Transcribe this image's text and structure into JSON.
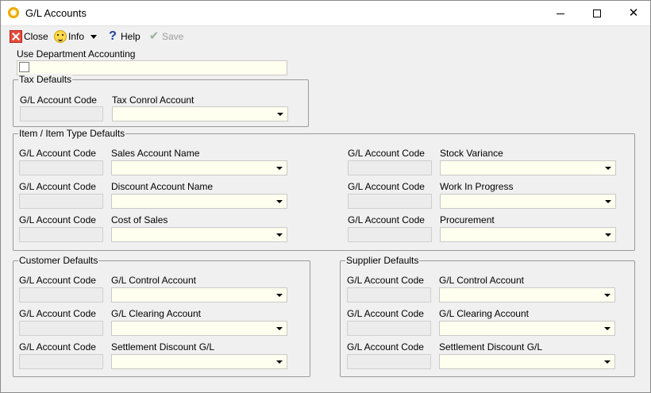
{
  "window": {
    "title": "G/L Accounts"
  },
  "toolbar": {
    "close_label": "Close",
    "info_label": "Info",
    "help_label": "Help",
    "save_label": "Save",
    "help_glyph": "?",
    "save_glyph": "✔"
  },
  "dept": {
    "label": "Use Department Accounting"
  },
  "tax": {
    "title": "Tax Defaults",
    "code_label": "G/L Account Code",
    "account_label": "Tax Conrol Account"
  },
  "item": {
    "title": "Item / Item Type Defaults",
    "rows": [
      {
        "code_label": "G/L Account Code",
        "account_label": "Sales Account Name"
      },
      {
        "code_label": "G/L Account Code",
        "account_label": "Discount Account Name"
      },
      {
        "code_label": "G/L Account Code",
        "account_label": "Cost of Sales"
      }
    ],
    "right_rows": [
      {
        "code_label": "G/L Account Code",
        "account_label": "Stock Variance"
      },
      {
        "code_label": "G/L Account Code",
        "account_label": "Work In Progress"
      },
      {
        "code_label": "G/L Account Code",
        "account_label": "Procurement"
      }
    ]
  },
  "customer": {
    "title": "Customer Defaults",
    "rows": [
      {
        "code_label": "G/L Account Code",
        "account_label": "G/L Control Account"
      },
      {
        "code_label": "G/L Account Code",
        "account_label": "G/L Clearing Account"
      },
      {
        "code_label": "G/L Account Code",
        "account_label": "Settlement Discount G/L"
      }
    ]
  },
  "supplier": {
    "title": "Supplier Defaults",
    "rows": [
      {
        "code_label": "G/L Account Code",
        "account_label": "G/L Control Account"
      },
      {
        "code_label": "G/L Account Code",
        "account_label": "G/L Clearing Account"
      },
      {
        "code_label": "G/L Account Code",
        "account_label": "Settlement Discount G/L"
      }
    ]
  }
}
